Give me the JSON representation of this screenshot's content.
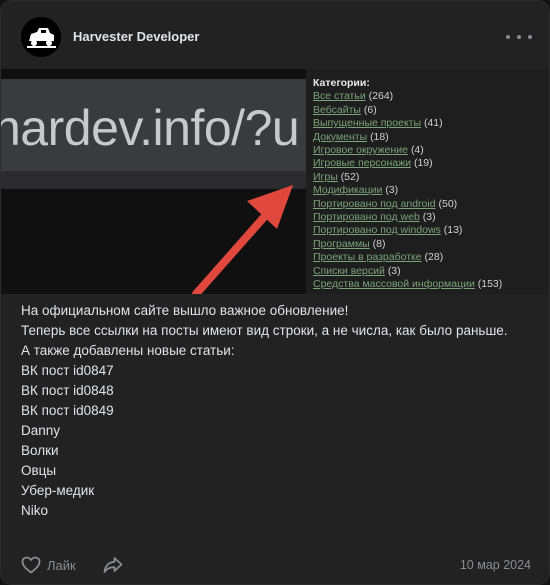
{
  "header": {
    "author": "Harvester Developer"
  },
  "screenshot": {
    "url_fragment": "hardev.info/?u",
    "categories_title": "Категории:",
    "categories": [
      {
        "name": "Все статьи",
        "count": "(264)"
      },
      {
        "name": "Вебсайты",
        "count": "(6)"
      },
      {
        "name": "Выпущенные проекты",
        "count": "(41)"
      },
      {
        "name": "Документы",
        "count": "(18)"
      },
      {
        "name": "Игровое окружение",
        "count": "(4)"
      },
      {
        "name": "Игровые персонажи",
        "count": "(19)"
      },
      {
        "name": "Игры",
        "count": "(52)"
      },
      {
        "name": "Модификации",
        "count": "(3)"
      },
      {
        "name": "Портировано под android",
        "count": "(50)"
      },
      {
        "name": "Портировано под web",
        "count": "(3)"
      },
      {
        "name": "Портировано под windows",
        "count": "(13)"
      },
      {
        "name": "Программы",
        "count": "(8)"
      },
      {
        "name": "Проекты в разработке",
        "count": "(28)"
      },
      {
        "name": "Списки версий",
        "count": "(3)"
      },
      {
        "name": "Средства массовой информации",
        "count": "(153)"
      }
    ]
  },
  "post": {
    "lines": [
      "На официальном сайте вышло важное обновление!",
      "Теперь все ссылки на посты имеют вид строки, а не числа, как было раньше.",
      "А также добавлены новые статьи:",
      "ВК пост id0847",
      "ВК пост id0848",
      "ВК пост id0849",
      "Danny",
      "Волки",
      "Овцы",
      "Убер-медик",
      "Niko"
    ]
  },
  "footer": {
    "like_label": "Лайк",
    "date": "10 мар 2024"
  },
  "colors": {
    "card_bg": "#222222",
    "text": "#e1e3e6",
    "muted": "#8a8c8f",
    "link_green": "#7aa37a",
    "arrow_red": "#e0483e"
  }
}
